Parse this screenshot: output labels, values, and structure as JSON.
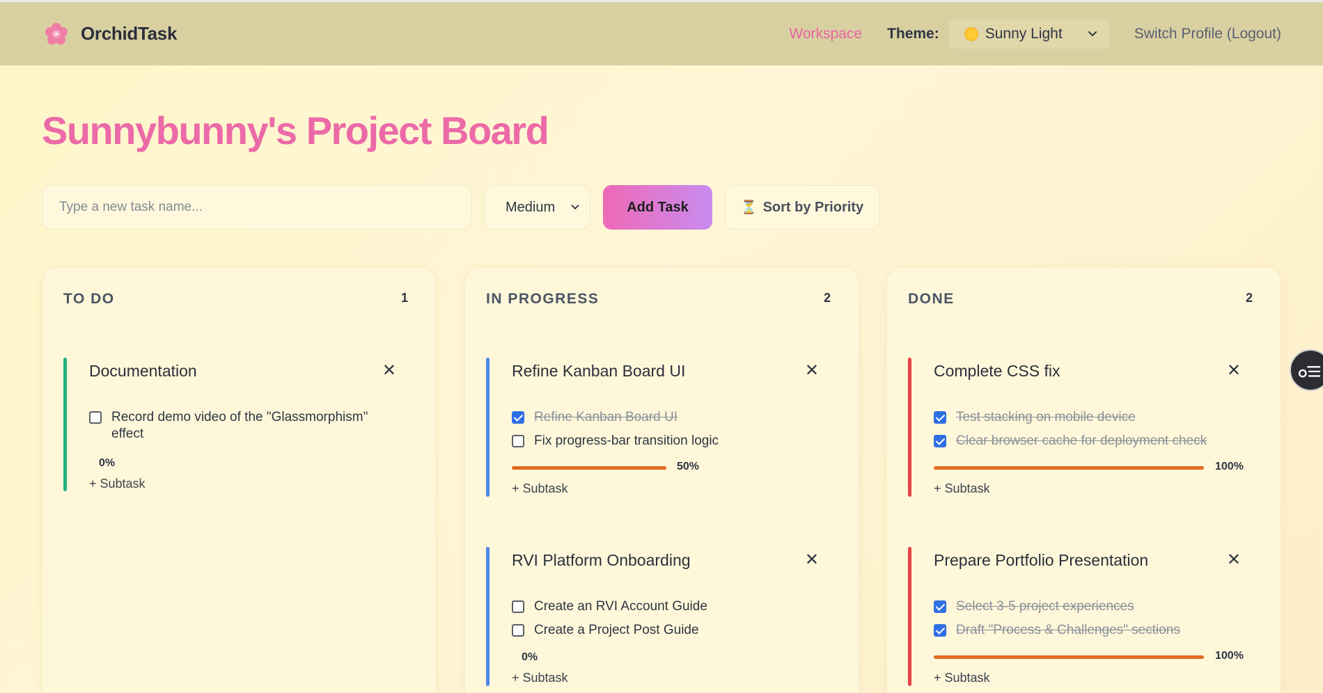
{
  "app": {
    "name": "OrchidTask"
  },
  "nav": {
    "workspace": "Workspace",
    "theme_label": "Theme:",
    "theme_value": "Sunny Light",
    "logout": "Switch Profile (Logout)"
  },
  "page": {
    "title": "Sunnybunny's Project Board"
  },
  "toolbar": {
    "task_placeholder": "Type a new task name...",
    "priority_value": "Medium",
    "add_label": "Add Task",
    "sort_label": "Sort by Priority"
  },
  "colors": {
    "accent": "#ec6aa8",
    "todo": "#22b07d",
    "in_progress": "#4f86e8",
    "done": "#e64545",
    "progress": "#e06a1f"
  },
  "columns": [
    {
      "title": "TO DO",
      "count": "1",
      "cards": [
        {
          "title": "Documentation",
          "progress": "0%",
          "add_subtask": "+ Subtask",
          "subtasks": [
            {
              "label": "Record demo video of the \"Glassmorphism\" effect",
              "done": false
            }
          ]
        }
      ]
    },
    {
      "title": "IN PROGRESS",
      "count": "2",
      "cards": [
        {
          "title": "Refine Kanban Board UI",
          "progress": "50%",
          "add_subtask": "+ Subtask",
          "subtasks": [
            {
              "label": "Refine Kanban Board UI",
              "done": true
            },
            {
              "label": "Fix progress-bar transition logic",
              "done": false
            }
          ]
        },
        {
          "title": "RVI Platform Onboarding",
          "progress": "0%",
          "add_subtask": "+ Subtask",
          "subtasks": [
            {
              "label": "Create an RVI Account Guide",
              "done": false
            },
            {
              "label": "Create a Project Post Guide",
              "done": false
            }
          ]
        }
      ]
    },
    {
      "title": "DONE",
      "count": "2",
      "cards": [
        {
          "title": "Complete CSS fix",
          "progress": "100%",
          "add_subtask": "+ Subtask",
          "subtasks": [
            {
              "label": "Test stacking on mobile device",
              "done": true
            },
            {
              "label": "Clear browser cache for deployment check",
              "done": true
            }
          ]
        },
        {
          "title": "Prepare Portfolio Presentation",
          "progress": "100%",
          "add_subtask": "+ Subtask",
          "subtasks": [
            {
              "label": "Select 3-5 project experiences",
              "done": true
            },
            {
              "label": "Draft \"Process & Challenges\" sections",
              "done": true
            }
          ]
        }
      ]
    }
  ]
}
